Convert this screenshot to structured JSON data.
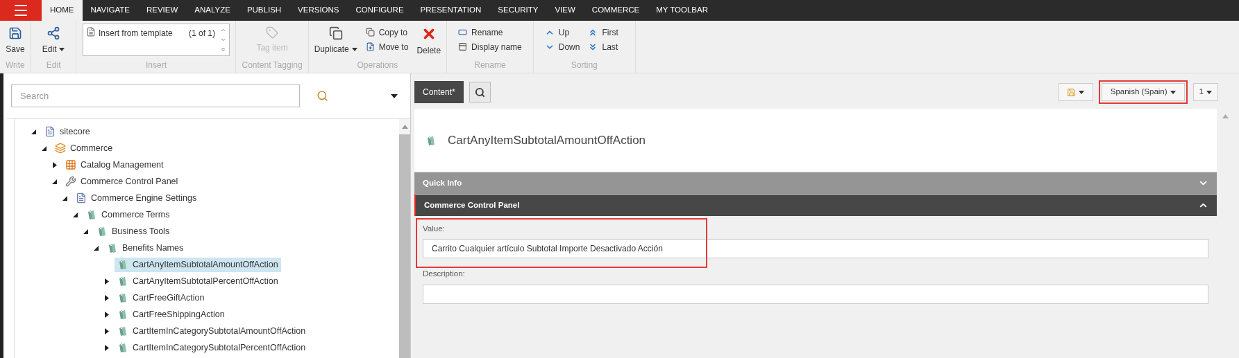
{
  "menu_tabs": [
    {
      "label": "HOME",
      "selected": true
    },
    {
      "label": "NAVIGATE",
      "selected": false
    },
    {
      "label": "REVIEW",
      "selected": false
    },
    {
      "label": "ANALYZE",
      "selected": false
    },
    {
      "label": "PUBLISH",
      "selected": false
    },
    {
      "label": "VERSIONS",
      "selected": false
    },
    {
      "label": "CONFIGURE",
      "selected": false
    },
    {
      "label": "PRESENTATION",
      "selected": false
    },
    {
      "label": "SECURITY",
      "selected": false
    },
    {
      "label": "VIEW",
      "selected": false
    },
    {
      "label": "COMMERCE",
      "selected": false
    },
    {
      "label": "MY TOOLBAR",
      "selected": false
    }
  ],
  "ribbon": {
    "write": {
      "label": "Write",
      "save": "Save"
    },
    "edit": {
      "label": "Edit",
      "edit": "Edit"
    },
    "insert": {
      "label": "Insert",
      "item": "Insert from template",
      "count": "(1 of 1)"
    },
    "tagging": {
      "label": "Content Tagging",
      "tag": "Tag item",
      "disabled": true
    },
    "operations": {
      "label": "Operations",
      "duplicate": "Duplicate",
      "copy": "Copy to",
      "move": "Move to",
      "delete": "Delete"
    },
    "rename": {
      "label": "Rename",
      "rename": "Rename",
      "display_name": "Display name"
    },
    "sorting": {
      "label": "Sorting",
      "up": "Up",
      "down": "Down",
      "first": "First",
      "last": "Last"
    }
  },
  "search": {
    "placeholder": "Search"
  },
  "tree": [
    {
      "label": "sitecore",
      "kind": "document",
      "expanded": true,
      "selected": false,
      "children": [
        {
          "label": "Commerce",
          "kind": "commerce",
          "expanded": true,
          "selected": false,
          "children": [
            {
              "label": "Catalog Management",
              "kind": "catalog",
              "expanded": false,
              "selected": false
            },
            {
              "label": "Commerce Control Panel",
              "kind": "tools",
              "expanded": true,
              "selected": false,
              "children": [
                {
                  "label": "Commerce Engine Settings",
                  "kind": "document",
                  "expanded": true,
                  "selected": false,
                  "children": [
                    {
                      "label": "Commerce Terms",
                      "kind": "term",
                      "expanded": true,
                      "selected": false,
                      "children": [
                        {
                          "label": "Business Tools",
                          "kind": "term",
                          "expanded": true,
                          "selected": false,
                          "children": [
                            {
                              "label": "Benefits Names",
                              "kind": "term",
                              "expanded": true,
                              "selected": false,
                              "children": [
                                {
                                  "label": "CartAnyItemSubtotalAmountOffAction",
                                  "kind": "term",
                                  "selected": true
                                },
                                {
                                  "label": "CartAnyItemSubtotalPercentOffAction",
                                  "kind": "term",
                                  "expanded": false,
                                  "selected": false
                                },
                                {
                                  "label": "CartFreeGiftAction",
                                  "kind": "term",
                                  "expanded": false,
                                  "selected": false
                                },
                                {
                                  "label": "CartFreeShippingAction",
                                  "kind": "term",
                                  "expanded": false,
                                  "selected": false
                                },
                                {
                                  "label": "CartItemInCategorySubtotalAmountOffAction",
                                  "kind": "term",
                                  "expanded": false,
                                  "selected": false
                                },
                                {
                                  "label": "CartItemInCategorySubtotalPercentOffAction",
                                  "kind": "term",
                                  "expanded": false,
                                  "selected": false
                                }
                              ]
                            }
                          ]
                        }
                      ]
                    }
                  ]
                }
              ]
            }
          ]
        }
      ]
    }
  ],
  "editor": {
    "tabs": [
      {
        "label": "Content*",
        "selected": true
      }
    ],
    "language": {
      "label": "Spanish (Spain)",
      "highlighted": true
    },
    "version": "1",
    "item_title": "CartAnyItemSubtotalAmountOffAction",
    "sections": [
      {
        "title": "Quick Info",
        "expanded": false
      },
      {
        "title": "Commerce Control Panel",
        "expanded": true,
        "fields": [
          {
            "label": "Value:",
            "value": "Carrito Cualquier artículo Subtotal Importe Desactivado Acción",
            "highlighted": true
          },
          {
            "label": "Description:",
            "highlighted": false
          }
        ]
      }
    ]
  }
}
